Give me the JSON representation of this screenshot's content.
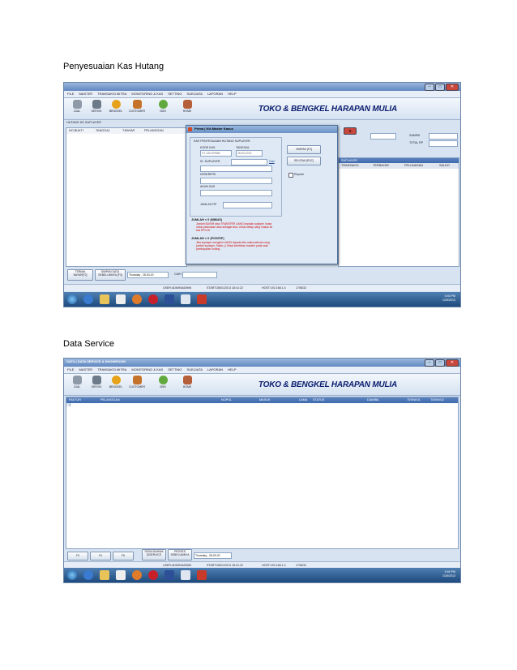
{
  "captions": {
    "first": "Penyesuaian Kas Hutang",
    "second": "Data Service"
  },
  "app": {
    "brand": "TOKO & BENGKEL HARAPAN MULIA",
    "menu": [
      "FILE",
      "MASTER",
      "TRANSAKSI MITRA",
      "MONITORING & KAS",
      "SETTING",
      "SUB.DATA",
      "LAPORAN",
      "HELP"
    ],
    "tools": [
      {
        "label": "JUAL",
        "color": "#8f9aa8"
      },
      {
        "label": "SERVIS",
        "color": "#6d7a8a"
      },
      {
        "label": "BENGKEL",
        "color": "#e7a21b"
      },
      {
        "label": "CUSTOMER",
        "color": "#c5732a"
      },
      {
        "label": "SMS",
        "color": "#61a93f"
      },
      {
        "label": "HOME",
        "color": "#b55e3a"
      }
    ],
    "status": {
      "user": "USER:ADMIN\\ADMIN",
      "start": "START:28/01/2013 18:41:22",
      "host": "HOST:192.168.1.4",
      "version": "1708/32"
    },
    "taskbar_time": "5:46 PM",
    "taskbar_date": "1/26/2013"
  },
  "shot1": {
    "panel_title": "HUTANG KE SUPLAYER",
    "columns": [
      "NO.BUKTI",
      "TANGGAL",
      "T.BAYAR",
      "PELANGGAN"
    ],
    "right_columns": [
      "TRANSAKSI",
      "TERBAYAR",
      "PELUNASAN",
      "SALDO"
    ],
    "right_header": "SUPLAYER",
    "right_fields": [
      "SAMPAI",
      "TOTAL RP"
    ],
    "bottom_buttons": [
      "TERIMA BAYAR[F2]",
      "SIMPAN DATA SEBELUMNYA [F3]"
    ],
    "day_select": "Thursday , 28-03-20",
    "cari_label": "CARI",
    "dialog": {
      "title": "Prima | Kik Master Kasus",
      "group": "KAS PENYESUAIAN HUTANG SUPLAYER",
      "kode_label": "KODE KAS",
      "kode_value": "KT-130-KRMM",
      "tanggal_label": "TANGGAL",
      "tanggal_value": "28-03-2013",
      "id_label": "ID. SUPLAYER",
      "cari_btn": "Cari",
      "deskripsi_label": "DESKRIPSI",
      "akun_label": "AKUN KAS",
      "jumlah_label": "JUMLAH RP",
      "simpan": "SIMPAN [F2]",
      "selesai": "SELESAI [ESC]",
      "repeat": "Repeat",
      "minus_title": "JUMLAH < 0 (MINUS)",
      "minus_text": "Jumlah BAYAR atau TRANSFER UANG kepada suplayer, biasa untuk pelunasan atau sebagai sisa, Untuk setiap uang masuk ke kas RPLUS",
      "plus_title": "JUMLAH > 0 (POSITIF)",
      "plus_text": "Jika suplayer mengirim UANG kepada kita maka sebuah uang jumlah suplayer, Saldo (-) Misal kelebihan transfer pada saat pembayaran hutang"
    }
  },
  "shot2": {
    "window_title": "DATA | DATA SERVICE & SHOWROOM",
    "columns": [
      "FAKTUR",
      "PELANGGAN",
      "NOPOL",
      "MASUK",
      "LAMA",
      "STATUS",
      "DIAMBIL",
      "TEKNISI1",
      "TEKNISI2"
    ],
    "bottom_buttons": [
      "F3",
      "F4",
      "F5",
      "SEDIA BAHWA DISERVICE",
      "PROSES SEBELUMNYA"
    ],
    "day_select": "Thursday , 28-03-20"
  }
}
